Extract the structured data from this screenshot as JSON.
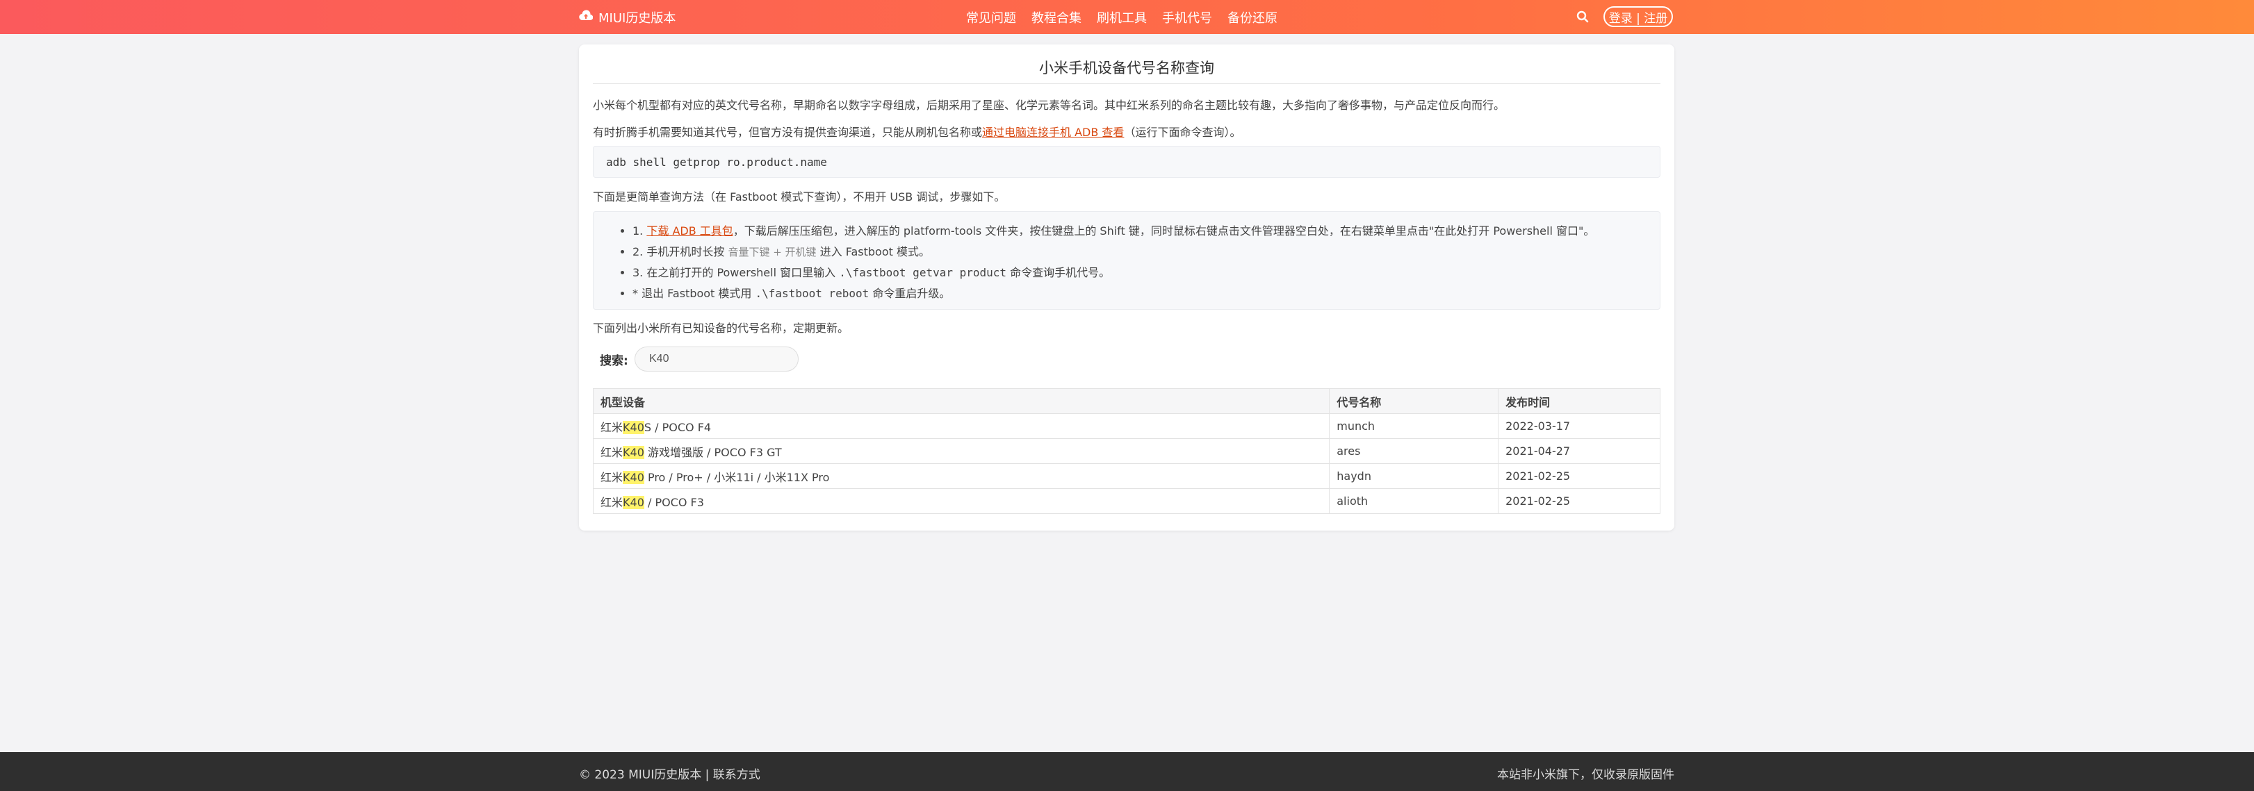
{
  "header": {
    "brand": "MIUI历史版本",
    "nav": [
      "常见问题",
      "教程合集",
      "刷机工具",
      "手机代号",
      "备份还原"
    ],
    "auth_label": "登录 | 注册"
  },
  "card": {
    "title": "小米手机设备代号名称查询",
    "intro1": "小米每个机型都有对应的英文代号名称，早期命名以数字字母组成，后期采用了星座、化学元素等名词。其中红米系列的命名主题比较有趣，大多指向了奢侈事物，与产品定位反向而行。",
    "intro2_pre": "有时折腾手机需要知道其代号，但官方没有提供查询渠道，只能从刷机包名称或",
    "intro2_link": "通过电脑连接手机 ADB 查看",
    "intro2_post": "（运行下面命令查询）。",
    "command": "adb shell getprop ro.product.name",
    "fastboot_intro": "下面是更简单查询方法（在 Fastboot 模式下查询），不用开 USB 调试，步骤如下。",
    "steps": {
      "s1_num": "1.",
      "s1_link": "下载 ADB 工具包",
      "s1_text": "，下载后解压压缩包，进入解压的 platform-tools 文件夹，按住键盘上的 Shift 键，同时鼠标右键点击文件管理器空白处，在右键菜单里点击\"在此处打开 Powershell 窗口\"。",
      "s2_pre": "2. 手机开机时长按",
      "s2_keys": "音量下键 + 开机键",
      "s2_post": "进入 Fastboot 模式。",
      "s3_pre": "3. 在之前打开的 Powershell 窗口里输入",
      "s3_cmd": ".\\fastboot getvar product",
      "s3_post": "命令查询手机代号。",
      "s4_pre": "* 退出 Fastboot 模式用",
      "s4_cmd": ".\\fastboot reboot",
      "s4_post": "命令重启升级。"
    },
    "list_intro": "下面列出小米所有已知设备的代号名称，定期更新。",
    "search": {
      "label": "搜索:",
      "value": "K40"
    },
    "table": {
      "headers": [
        "机型设备",
        "代号名称",
        "发布时间"
      ],
      "rows": [
        {
          "pre": "红米",
          "hl": "K40",
          "post": "S / POCO F4",
          "code": "munch",
          "date": "2022-03-17"
        },
        {
          "pre": "红米",
          "hl": "K40",
          "post": " 游戏增强版 / POCO F3 GT",
          "code": "ares",
          "date": "2021-04-27"
        },
        {
          "pre": "红米",
          "hl": "K40",
          "post": " Pro / Pro+ / 小米11i / 小米11X Pro",
          "code": "haydn",
          "date": "2021-02-25"
        },
        {
          "pre": "红米",
          "hl": "K40",
          "post": " / POCO F3",
          "code": "alioth",
          "date": "2021-02-25"
        }
      ]
    }
  },
  "footer": {
    "left": "© 2023 MIUI历史版本 | 联系方式",
    "right": "本站非小米旗下，仅收录原版固件"
  },
  "icons": {
    "brand": "cloud-upload-icon",
    "search": "search-icon"
  },
  "colors": {
    "header_start": "#fb5a5c",
    "header_end": "#ff8a3a",
    "link": "#d9480f",
    "highlight": "#fff36b",
    "footer": "#2f2f2f"
  }
}
